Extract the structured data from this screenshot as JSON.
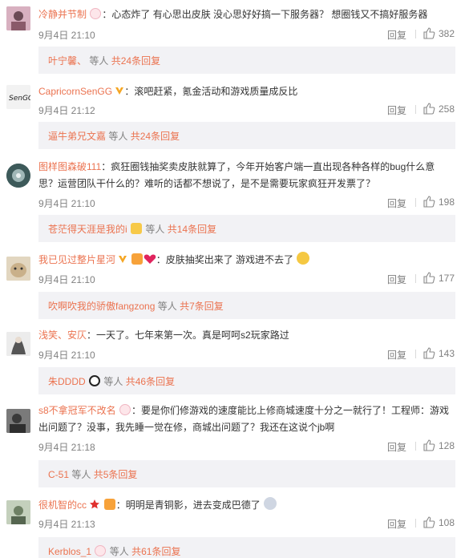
{
  "comments": [
    {
      "username": "冷静并节制",
      "text": "：心态炸了   有心思出皮肤  没心思好好搞一下服务器？ 想圈钱又不搞好服务器",
      "time": "9月4日 21:10",
      "reply_label": "回复",
      "likes": "382",
      "sub_name": "叶宁馨、",
      "sub_suffix": "等人",
      "sub_more": "共24条回复",
      "avatar_color": "#c9a3b5"
    },
    {
      "username": "CapricornSenGG",
      "text": "：滚吧赶紧，氪金活动和游戏质量成反比",
      "time": "9月4日 21:12",
      "reply_label": "回复",
      "likes": "258",
      "sub_name": "逼牛弟兄文嘉",
      "sub_suffix": "等人",
      "sub_more": "共24条回复",
      "avatar_color": "#e8e8e8"
    },
    {
      "username": "图样图森破111",
      "text_line1": "：疯狂圈钱抽奖卖皮肤就算了，今年开始客户端一直出现各种各样的bug什么意",
      "text_line2": "思？运营团队干什么的？难听的话都不想说了，是不是需要玩家疯狂开发票了？",
      "time": "9月4日 21:10",
      "reply_label": "回复",
      "likes": "198",
      "sub_name": "苍茫得天涯是我的i",
      "sub_suffix": "等人",
      "sub_more": "共14条回复",
      "avatar_color": "#2f4f4f"
    },
    {
      "username": "我已见过整片星河",
      "text": "：皮肤抽奖出来了 游戏进不去了",
      "time": "9月4日 21:10",
      "reply_label": "回复",
      "likes": "177",
      "sub_name": "吹啊吹我的骄傲fangzong",
      "sub_suffix": "等人",
      "sub_more": "共7条回复",
      "avatar_color": "#d9c7a8"
    },
    {
      "username": "浅笑、安仄",
      "text": "：一天了。七年来第一次。真是呵呵s2玩家路过",
      "time": "9月4日 21:10",
      "reply_label": "回复",
      "likes": "143",
      "sub_name": "朱DDDD",
      "sub_suffix": "等人",
      "sub_more": "共46条回复",
      "avatar_color": "#dcdcdc"
    },
    {
      "username": "s8不拿冠军不改名",
      "text_line1": "：要是你们修游戏的速度能比上修商城速度十分之一就行了！工程师：游戏",
      "text_line2": "出问题了？没事，我先睡一觉在修，商城出问题了？我还在这说个jb啊",
      "time": "9月4日 21:18",
      "reply_label": "回复",
      "likes": "128",
      "sub_name": "C-51",
      "sub_suffix": "等人",
      "sub_more": "共5条回复",
      "avatar_color": "#6b6b6b"
    },
    {
      "username": "很机智的cc",
      "text": "：明明是青铜影，进去变成巴德了",
      "time": "9月4日 21:13",
      "reply_label": "回复",
      "likes": "108",
      "sub_name": "Kerblos_1",
      "sub_suffix": "等人",
      "sub_more": "共61条回复",
      "avatar_color": "#a9b8a0"
    }
  ],
  "colors": {
    "username": "#eb7350",
    "meta": "#808080",
    "sub_bg": "#f2f2f5",
    "v_badge": "#f5a623",
    "heart": "#e0245e"
  },
  "icons": [
    "thumbs-up-icon",
    "rabbit-emoji-icon",
    "v-badge-icon",
    "heart-emoji-icon",
    "panda-emoji-icon",
    "star-emoji-icon",
    "crown-emoji-icon",
    "cat-emoji-icon"
  ]
}
